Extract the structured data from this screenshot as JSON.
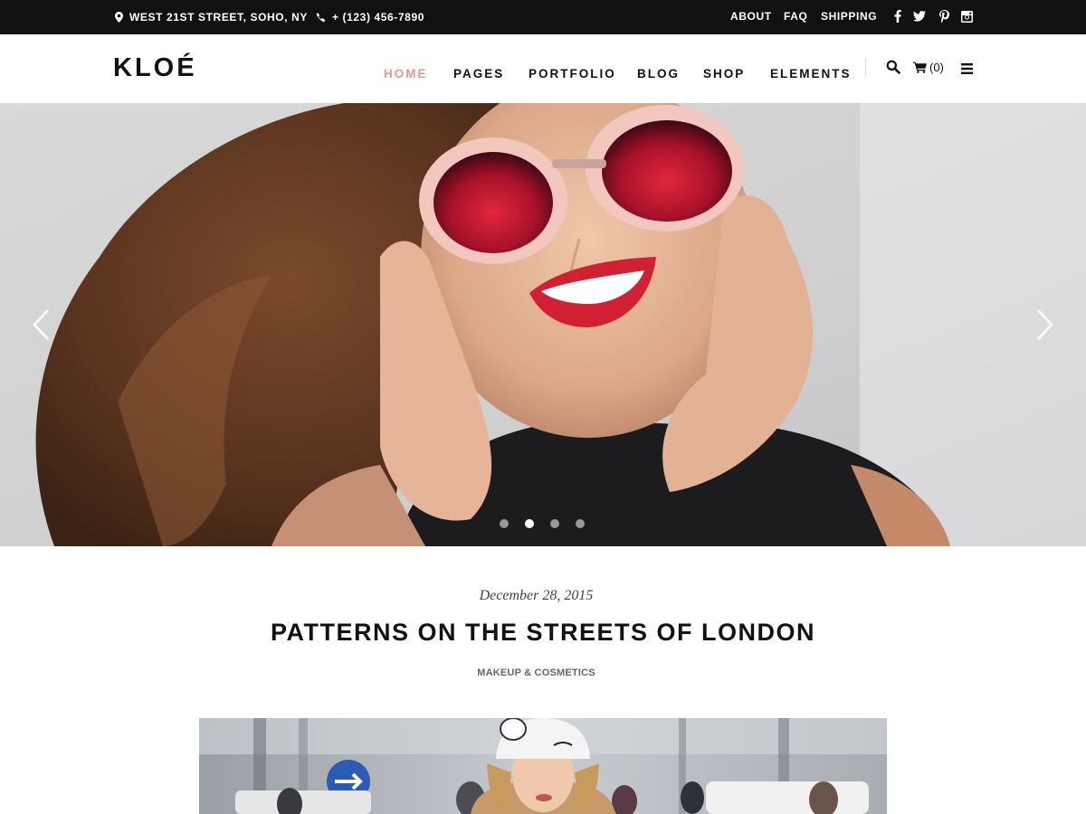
{
  "topbar": {
    "address": "WEST 21ST STREET, SOHO, NY",
    "phone": "+ (123) 456-7890",
    "links": {
      "about": "ABOUT",
      "faq": "FAQ",
      "shipping": "SHIPPING"
    },
    "social": [
      "facebook-icon",
      "twitter-icon",
      "pinterest-icon",
      "instagram-icon"
    ]
  },
  "header": {
    "logo": "KLOÉ",
    "nav": {
      "home": "HOME",
      "pages": "PAGES",
      "portfolio": "PORTFOLIO",
      "blog": "BLOG",
      "shop": "SHOP",
      "elements": "ELEMENTS"
    },
    "active_nav": "HOME",
    "cart_count": "(0)"
  },
  "hero": {
    "slides_total": 4,
    "active_slide": 2
  },
  "post": {
    "date": "December 28, 2015",
    "title": "PATTERNS ON THE STREETS OF LONDON",
    "category": "MAKEUP & COSMETICS"
  },
  "colors": {
    "accent": "#e59a93",
    "topbar_bg": "#111111",
    "text": "#111111"
  }
}
